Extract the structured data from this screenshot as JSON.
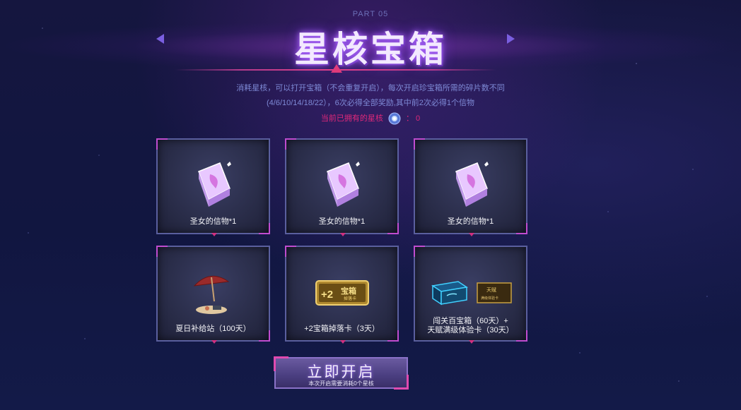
{
  "header": {
    "part_label": "PART 05",
    "title": "星核宝箱",
    "prev_icon": "triangle-left-icon",
    "next_icon": "triangle-right-icon"
  },
  "description": {
    "line1": "消耗星核，可以打开宝箱（不会重复开启），每次开启珍宝箱所需的碎片数不同",
    "line2": "(4/6/10/14/18/22），6次必得全部奖励,其中前2次必得1个信物"
  },
  "owned": {
    "label": "当前已拥有的星核",
    "separator": "：",
    "count": "0",
    "icon": "star-core-icon"
  },
  "rewards": [
    {
      "label": "圣女的信物*1",
      "icon": "crystal-book-icon"
    },
    {
      "label": "圣女的信物*1",
      "icon": "crystal-book-icon"
    },
    {
      "label": "圣女的信物*1",
      "icon": "crystal-book-icon"
    },
    {
      "label": "夏日补给站（100天）",
      "icon": "beach-umbrella-icon"
    },
    {
      "label": "+2宝箱掉落卡（3天）",
      "icon": "gold-card-icon"
    },
    {
      "label_line1": "闯关百宝箱（60天）+",
      "label_line2": "天赋满级体验卡（30天）",
      "icon": "treasure-box-icon",
      "badge_text": "天赋",
      "badge_sub": "满级体验卡"
    }
  ],
  "gold_card": {
    "plus": "+2",
    "main": "宝箱",
    "sub": "掉落卡"
  },
  "start_button": {
    "label": "立即开启",
    "sublabel": "本次开启需要消耗0个星核"
  },
  "colors": {
    "accent_pink": "#e0287a",
    "desc_blue": "#7e8ad6",
    "card_border": "#5a5f9e"
  }
}
